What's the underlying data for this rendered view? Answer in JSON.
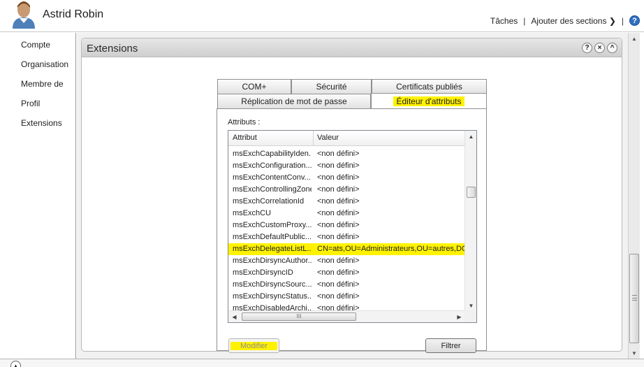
{
  "header": {
    "user_name": "Astrid Robin",
    "tasks_label": "Tâches",
    "add_sections_label": "Ajouter des sections",
    "help_glyph": "?"
  },
  "nav": {
    "items": [
      {
        "label": "Compte"
      },
      {
        "label": "Organisation"
      },
      {
        "label": "Membre de"
      },
      {
        "label": "Profil"
      },
      {
        "label": "Extensions"
      }
    ]
  },
  "panel": {
    "title": "Extensions",
    "controls": [
      "?",
      "×",
      "^"
    ]
  },
  "dialog": {
    "tabs_row1": [
      {
        "label": "COM+"
      },
      {
        "label": "Sécurité"
      },
      {
        "label": "Certificats publiés"
      }
    ],
    "tabs_row2": [
      {
        "label": "Réplication de mot de passe"
      },
      {
        "label": "Éditeur d'attributs",
        "active": true
      }
    ],
    "attributes_label": "Attributs :",
    "columns": [
      "Attribut",
      "Valeur"
    ],
    "rows": [
      {
        "attr": "msExchCapabilityIden...",
        "value": "<non défini>"
      },
      {
        "attr": "msExchConfiguration...",
        "value": "<non défini>"
      },
      {
        "attr": "msExchContentConv...",
        "value": "<non défini>"
      },
      {
        "attr": "msExchControllingZone",
        "value": "<non défini>"
      },
      {
        "attr": "msExchCorrelationId",
        "value": "<non défini>"
      },
      {
        "attr": "msExchCU",
        "value": "<non défini>"
      },
      {
        "attr": "msExchCustomProxy...",
        "value": "<non défini>"
      },
      {
        "attr": "msExchDefaultPublic...",
        "value": "<non défini>"
      },
      {
        "attr": "msExchDelegateListL...",
        "value": "CN=ats,OU=Administrateurs,OU=autres,DC=",
        "selected": true
      },
      {
        "attr": "msExchDirsyncAuthor...",
        "value": "<non défini>"
      },
      {
        "attr": "msExchDirsyncID",
        "value": "<non défini>"
      },
      {
        "attr": "msExchDirsyncSourc...",
        "value": "<non défini>"
      },
      {
        "attr": "msExchDirsyncStatus...",
        "value": "<non défini>"
      },
      {
        "attr": "msExchDisabledArchi...",
        "value": "<non défini>"
      }
    ],
    "hscroll_grip": "III",
    "modify_button": "Modifier",
    "filter_button": "Filtrer"
  },
  "colors": {
    "highlight": "#fff200",
    "help_blue": "#2f6ec0"
  }
}
